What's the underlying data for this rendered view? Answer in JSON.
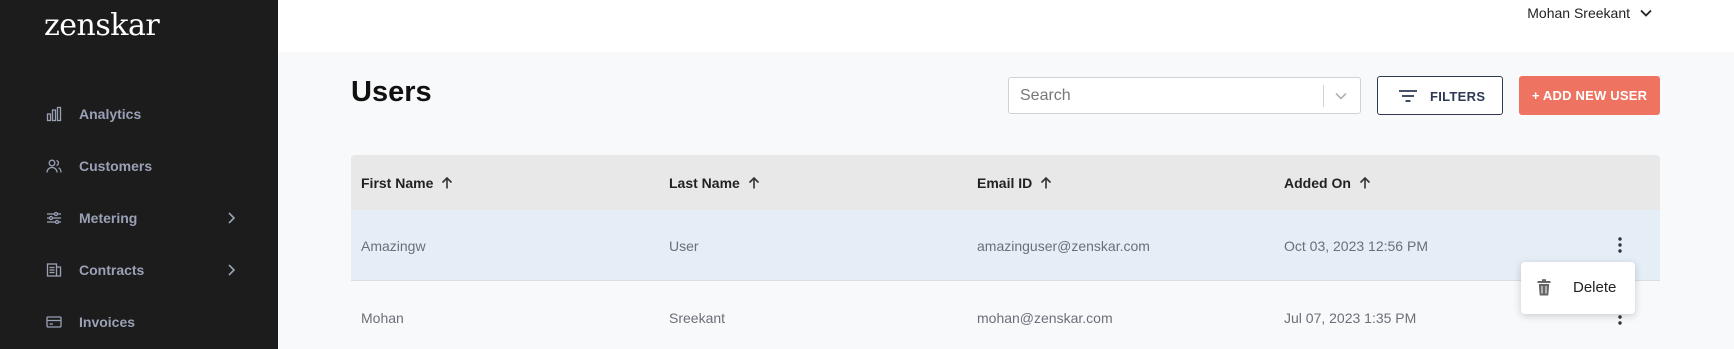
{
  "sidebar": {
    "logo": "zenskar",
    "items": [
      {
        "label": "Analytics",
        "icon": "bar-chart-icon",
        "has_submenu": false
      },
      {
        "label": "Customers",
        "icon": "users-icon",
        "has_submenu": false
      },
      {
        "label": "Metering",
        "icon": "sliders-icon",
        "has_submenu": true
      },
      {
        "label": "Contracts",
        "icon": "contract-icon",
        "has_submenu": true
      },
      {
        "label": "Invoices",
        "icon": "invoice-icon",
        "has_submenu": false
      }
    ]
  },
  "topbar": {
    "user_name": "Mohan Sreekant"
  },
  "page": {
    "title": "Users"
  },
  "search": {
    "placeholder": "Search",
    "value": ""
  },
  "toolbar": {
    "filters_label": "FILTERS",
    "add_label": "+ ADD NEW USER"
  },
  "table": {
    "columns": [
      "First Name",
      "Last Name",
      "Email ID",
      "Added On"
    ],
    "rows": [
      {
        "first_name": "Amazingw",
        "last_name": "User",
        "email": "amazinguser@zenskar.com",
        "added_on": "Oct 03, 2023 12:56 PM",
        "selected": true
      },
      {
        "first_name": "Mohan",
        "last_name": "Sreekant",
        "email": "mohan@zenskar.com",
        "added_on": "Jul 07, 2023 1:35 PM",
        "selected": false
      }
    ]
  },
  "context_menu": {
    "delete_label": "Delete"
  },
  "colors": {
    "sidebar_bg": "#1c1c1c",
    "accent": "#ee7360",
    "nav_text": "#9aa0b5",
    "selected_row": "#e5edf6"
  }
}
